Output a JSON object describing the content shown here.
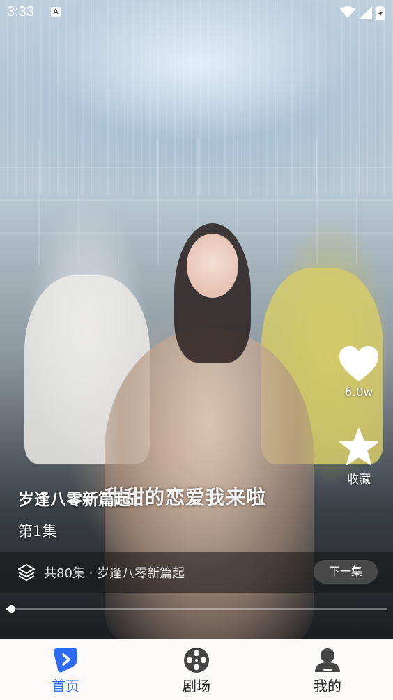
{
  "status_bar": {
    "time": "3:33",
    "notification": "A"
  },
  "video": {
    "caption": "甜甜的恋爱我来啦",
    "drama_title": "岁逢八零新篇起",
    "episode_label": "第1集",
    "progress": 0.01
  },
  "actions": {
    "like": {
      "icon": "heart-icon",
      "count": "6.0w"
    },
    "collect": {
      "icon": "star-icon",
      "label": "收藏"
    }
  },
  "episode_bar": {
    "info": "共80集 · 岁逢八零新篇起",
    "next_label": "下一集"
  },
  "bottom_nav": {
    "items": [
      {
        "label": "首页",
        "icon": "play-icon",
        "active": true
      },
      {
        "label": "剧场",
        "icon": "film-reel-icon",
        "active": false
      },
      {
        "label": "我的",
        "icon": "user-icon",
        "active": false
      }
    ]
  },
  "colors": {
    "accent": "#2f6bf2",
    "nav_background": "#fcf9f9"
  }
}
